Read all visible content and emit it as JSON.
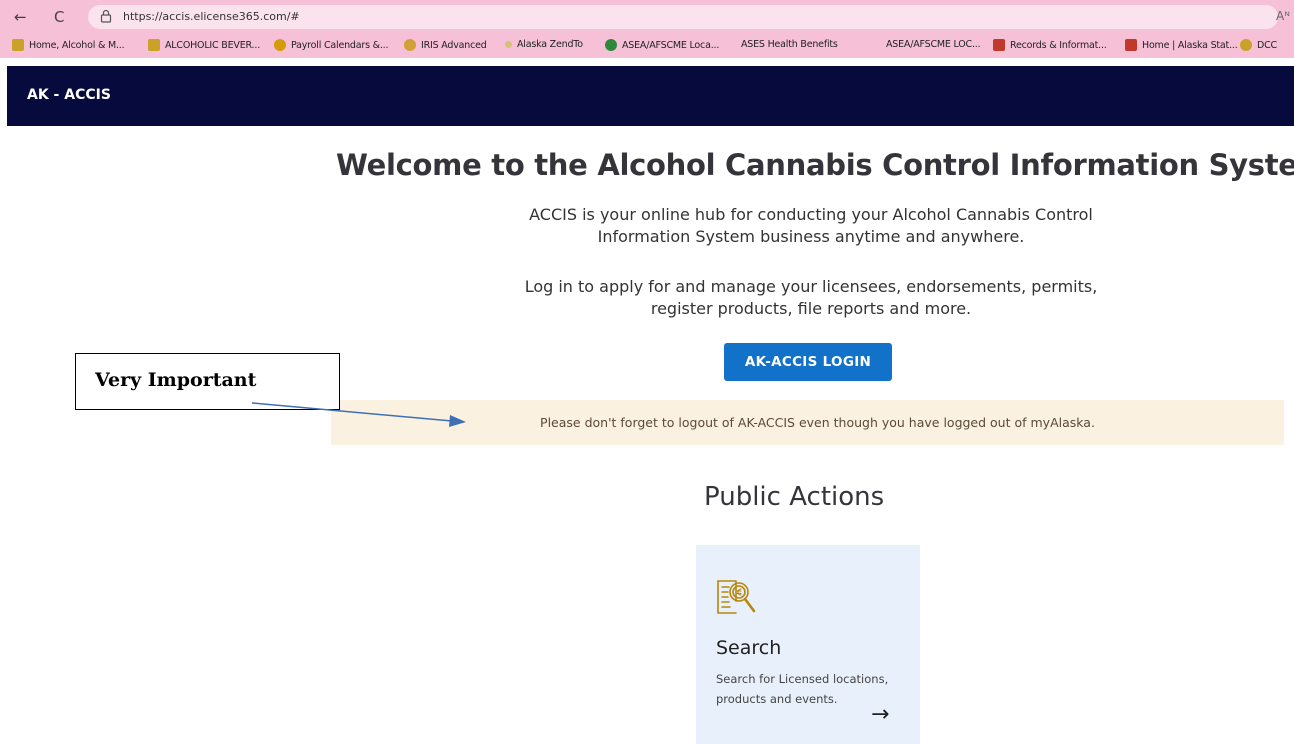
{
  "browser": {
    "back_glyph": "←",
    "reload_glyph": "C",
    "url": "https://accis.elicense365.com/#",
    "reader_label": "Aᴺ",
    "bookmarks": [
      {
        "label": "Home, Alcohol & M...",
        "icon": "ak-icon",
        "color": "#c9a227"
      },
      {
        "label": "ALCOHOLIC BEVER...",
        "icon": "ak-icon",
        "color": "#c9a227"
      },
      {
        "label": "Payroll Calendars &...",
        "icon": "globe-icon",
        "color": "#d49b0b"
      },
      {
        "label": "IRIS Advanced",
        "icon": "iris-icon",
        "color": "#d1a036"
      },
      {
        "label": "Alaska ZendTo",
        "icon": "dot-icon",
        "color": "#d6c07a"
      },
      {
        "label": "ASEA/AFSCME Loca...",
        "icon": "union-icon",
        "color": "#2d8a3a"
      },
      {
        "label": "ASES Health Benefits",
        "icon": "none",
        "color": ""
      },
      {
        "label": "ASEA/AFSCME LOC...",
        "icon": "none",
        "color": ""
      },
      {
        "label": "Records & Informat...",
        "icon": "building-icon",
        "color": "#c0392b"
      },
      {
        "label": "Home | Alaska Stat...",
        "icon": "building-icon",
        "color": "#c0392b"
      },
      {
        "label": "DCC",
        "icon": "circle-icon",
        "color": "#c9a227"
      }
    ]
  },
  "header": {
    "app_name": "AK - ACCIS"
  },
  "main": {
    "welcome_title": "Welcome to the Alcohol Cannabis Control Information System",
    "intro_line1": "ACCIS is your online hub for conducting your Alcohol Cannabis Control",
    "intro_line2": "Information System business anytime and anywhere.",
    "login_line1": "Log in to apply for and manage your licensees, endorsements, permits,",
    "login_line2": "register products, file reports and more.",
    "login_button": "AK-ACCIS LOGIN",
    "alert_text": "Please don't forget to logout of AK-ACCIS even though you have logged out of myAlaska."
  },
  "annotation": {
    "text": "Very Important"
  },
  "public_actions": {
    "title": "Public Actions",
    "cards": [
      {
        "icon": "search-document-icon",
        "title": "Search",
        "description": "Search for Licensed locations, products and events.",
        "arrow": "→"
      }
    ]
  },
  "colors": {
    "chrome": "#f6c1d7",
    "header": "#070a3d",
    "button": "#1271c9",
    "alert_bg": "#fbf1e0",
    "card_bg": "#e8f1fb",
    "icon_gold": "#b8860b"
  }
}
